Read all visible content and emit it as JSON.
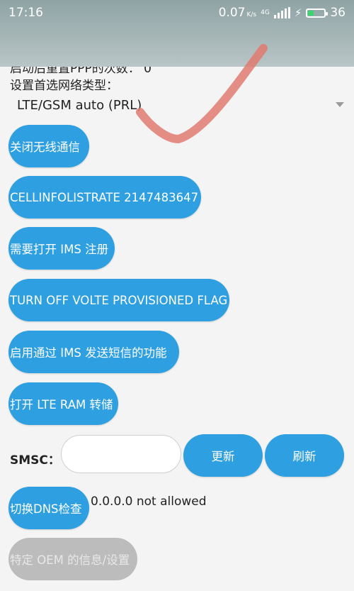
{
  "status_bar": {
    "time": "17:16",
    "net_speed": "0.07",
    "net_speed_unit": "K/s",
    "network_type": "4G",
    "battery_level": "36"
  },
  "settings": {
    "truncated_row": "启动后重置PPP的次数： 0",
    "network_type_label": "设置首选网络类型：",
    "network_type_value": "LTE/GSM auto (PRL)"
  },
  "buttons": {
    "radio_off": "关闭无线通信",
    "cell_info_rate": "CELLINFOLISTRATE 2147483647",
    "ims_registration": "需要打开 IMS 注册",
    "volte_flag": "TURN OFF VOLTE PROVISIONED FLAG",
    "sms_over_ims": "启用通过 IMS 发送短信的功能",
    "lte_ram_dump": "打开 LTE RAM 转储",
    "update": "更新",
    "refresh": "刷新",
    "dns_check": "切换DNS检查",
    "oem_info": "特定 OEM 的信息/设置"
  },
  "smsc": {
    "label": "SMSC：",
    "value": ""
  },
  "dns_status": "0.0.0.0 not allowed",
  "colors": {
    "accent": "#2e9fe0",
    "disabled": "#bcbcbc",
    "gesture": "#e07a70"
  }
}
